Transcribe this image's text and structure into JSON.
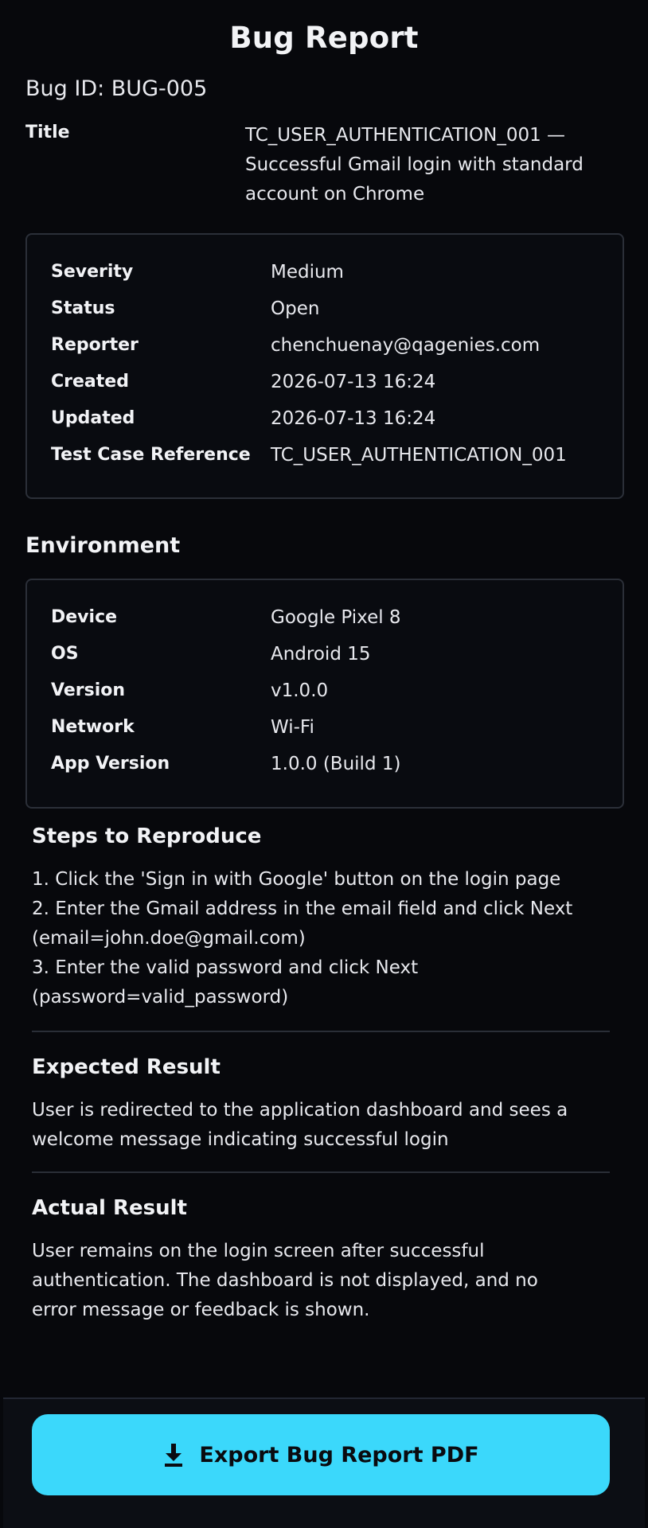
{
  "header": {
    "title": "Bug Report",
    "bug_id": "Bug ID: BUG-005"
  },
  "title_field": {
    "label": "Title",
    "lines": [
      "TC_USER_AUTHENTICATION_001 —",
      "Successful Gmail login with standard",
      "account on Chrome"
    ]
  },
  "meta": [
    {
      "key": "Severity",
      "value": "Medium"
    },
    {
      "key": "Status",
      "value": "Open"
    },
    {
      "key": "Reporter",
      "value": "chenchuenay@qagenies.com"
    },
    {
      "key": "Created",
      "value": "2026-07-13 16:24"
    },
    {
      "key": "Updated",
      "value": "2026-07-13 16:24"
    },
    {
      "key": "Test Case Reference",
      "value": "TC_USER_AUTHENTICATION_001"
    }
  ],
  "environment": {
    "heading": "Environment",
    "rows": [
      {
        "key": "Device",
        "value": "Google Pixel 8"
      },
      {
        "key": "OS",
        "value": "Android 15"
      },
      {
        "key": "Version",
        "value": "v1.0.0"
      },
      {
        "key": "Network",
        "value": "Wi-Fi"
      },
      {
        "key": "App Version",
        "value": "1.0.0 (Build 1)"
      }
    ]
  },
  "steps": {
    "heading": "Steps to Reproduce",
    "lines": [
      "1. Click the 'Sign in with Google' button on the login page",
      "2. Enter the Gmail address in the email field and click Next",
      "(email=john.doe@gmail.com)",
      "3. Enter the valid password and click Next",
      "(password=valid_password)"
    ]
  },
  "expected": {
    "heading": "Expected Result",
    "lines": [
      "User is redirected to the application dashboard and sees a",
      "welcome message indicating successful login"
    ]
  },
  "actual": {
    "heading": "Actual Result",
    "lines": [
      "User remains on the login screen after successful",
      "authentication. The dashboard is not displayed, and no",
      "error message or feedback is shown."
    ]
  },
  "footer": {
    "export_label": "Export Bug Report PDF",
    "export_icon": "download-icon",
    "accent_color": "#3bd8fb"
  }
}
